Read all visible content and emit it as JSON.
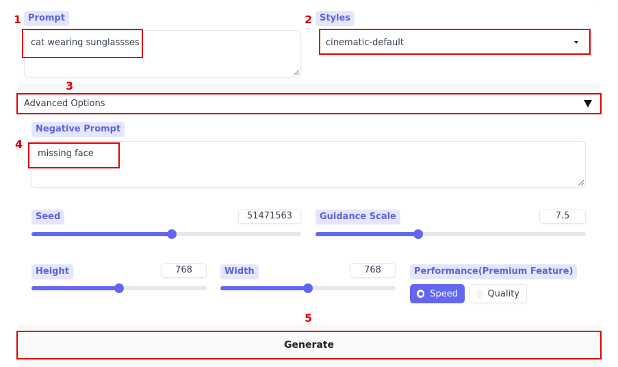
{
  "prompt": {
    "label": "Prompt",
    "value": "cat wearing sunglassses"
  },
  "styles": {
    "label": "Styles",
    "selected": "cinematic-default"
  },
  "advanced": {
    "label": "Advanced Options"
  },
  "negative_prompt": {
    "label": "Negative Prompt",
    "value": "missing face"
  },
  "seed": {
    "label": "Seed",
    "value": "51471563",
    "slider_fraction": 0.52
  },
  "guidance": {
    "label": "Guidance Scale",
    "value": "7.5",
    "slider_fraction": 0.38
  },
  "height": {
    "label": "Height",
    "value": "768",
    "slider_fraction": 0.5
  },
  "width": {
    "label": "Width",
    "value": "768",
    "slider_fraction": 0.5
  },
  "performance": {
    "label": "Performance(Premium Feature)",
    "options": [
      "Speed",
      "Quality"
    ],
    "selected": "Speed"
  },
  "generate": {
    "label": "Generate"
  },
  "annotations": [
    "1",
    "2",
    "3",
    "4",
    "5"
  ],
  "colors": {
    "accent": "#6366f1",
    "annotation": "#e00000",
    "chip_bg": "#e4e7fb"
  }
}
